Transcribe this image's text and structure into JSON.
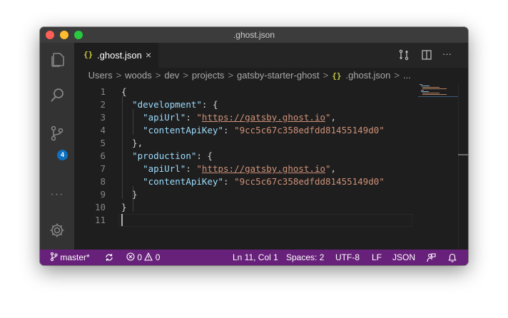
{
  "window": {
    "title": ".ghost.json"
  },
  "tab": {
    "icon_text": "{}",
    "label": ".ghost.json",
    "close_glyph": "×",
    "icon": "json-braces-icon"
  },
  "tab_actions": {
    "icons": [
      "open-changes-icon",
      "split-editor-icon",
      "more-actions-icon"
    ],
    "more_glyph": "···"
  },
  "activity": {
    "scm_badge": "4",
    "icons": [
      "explorer-icon",
      "search-icon",
      "source-control-icon",
      "more-icon",
      "settings-gear-icon"
    ],
    "more_glyph": "···"
  },
  "breadcrumb": {
    "items": [
      "Users",
      "woods",
      "dev",
      "projects",
      "gatsby-starter-ghost"
    ],
    "file_icon_text": "{}",
    "file": ".ghost.json",
    "ellipsis": "...",
    "separator": ">"
  },
  "editor": {
    "line_numbers": [
      "1",
      "2",
      "3",
      "4",
      "5",
      "6",
      "7",
      "8",
      "9",
      "10",
      "11"
    ],
    "lines": [
      [
        {
          "t": "p",
          "v": "{"
        }
      ],
      [
        {
          "t": "p",
          "v": "  "
        },
        {
          "t": "k",
          "v": "\"development\""
        },
        {
          "t": "p",
          "v": ": {"
        }
      ],
      [
        {
          "t": "p",
          "v": "    "
        },
        {
          "t": "k",
          "v": "\"apiUrl\""
        },
        {
          "t": "p",
          "v": ": "
        },
        {
          "t": "s",
          "v": "\""
        },
        {
          "t": "u",
          "v": "https://gatsby.ghost.io"
        },
        {
          "t": "s",
          "v": "\""
        },
        {
          "t": "p",
          "v": ","
        }
      ],
      [
        {
          "t": "p",
          "v": "    "
        },
        {
          "t": "k",
          "v": "\"contentApiKey\""
        },
        {
          "t": "p",
          "v": ": "
        },
        {
          "t": "s",
          "v": "\"9cc5c67c358edfdd81455149d0\""
        }
      ],
      [
        {
          "t": "p",
          "v": "  },"
        }
      ],
      [
        {
          "t": "p",
          "v": "  "
        },
        {
          "t": "k",
          "v": "\"production\""
        },
        {
          "t": "p",
          "v": ": {"
        }
      ],
      [
        {
          "t": "p",
          "v": "    "
        },
        {
          "t": "k",
          "v": "\"apiUrl\""
        },
        {
          "t": "p",
          "v": ": "
        },
        {
          "t": "s",
          "v": "\""
        },
        {
          "t": "u",
          "v": "https://gatsby.ghost.io"
        },
        {
          "t": "s",
          "v": "\""
        },
        {
          "t": "p",
          "v": ","
        }
      ],
      [
        {
          "t": "p",
          "v": "    "
        },
        {
          "t": "k",
          "v": "\"contentApiKey\""
        },
        {
          "t": "p",
          "v": ": "
        },
        {
          "t": "s",
          "v": "\"9cc5c67c358edfdd81455149d0\""
        }
      ],
      [
        {
          "t": "p",
          "v": "  }"
        }
      ],
      [
        {
          "t": "p",
          "v": "}"
        }
      ],
      []
    ],
    "cursor_line": 11
  },
  "status": {
    "branch": "master*",
    "sync_icon": "sync-icon",
    "errors": "0",
    "warnings": "0",
    "position": "Ln 11, Col 1",
    "spaces": "Spaces: 2",
    "encoding": "UTF-8",
    "eol": "LF",
    "language": "JSON",
    "feedback_icon": "feedback-icon",
    "bell_icon": "bell-icon"
  },
  "colors": {
    "status_bar": "#68217a",
    "editor_bg": "#1e1e1e",
    "json_key": "#9cdcfe",
    "json_string": "#ce9178",
    "badge": "#0e70c0"
  }
}
